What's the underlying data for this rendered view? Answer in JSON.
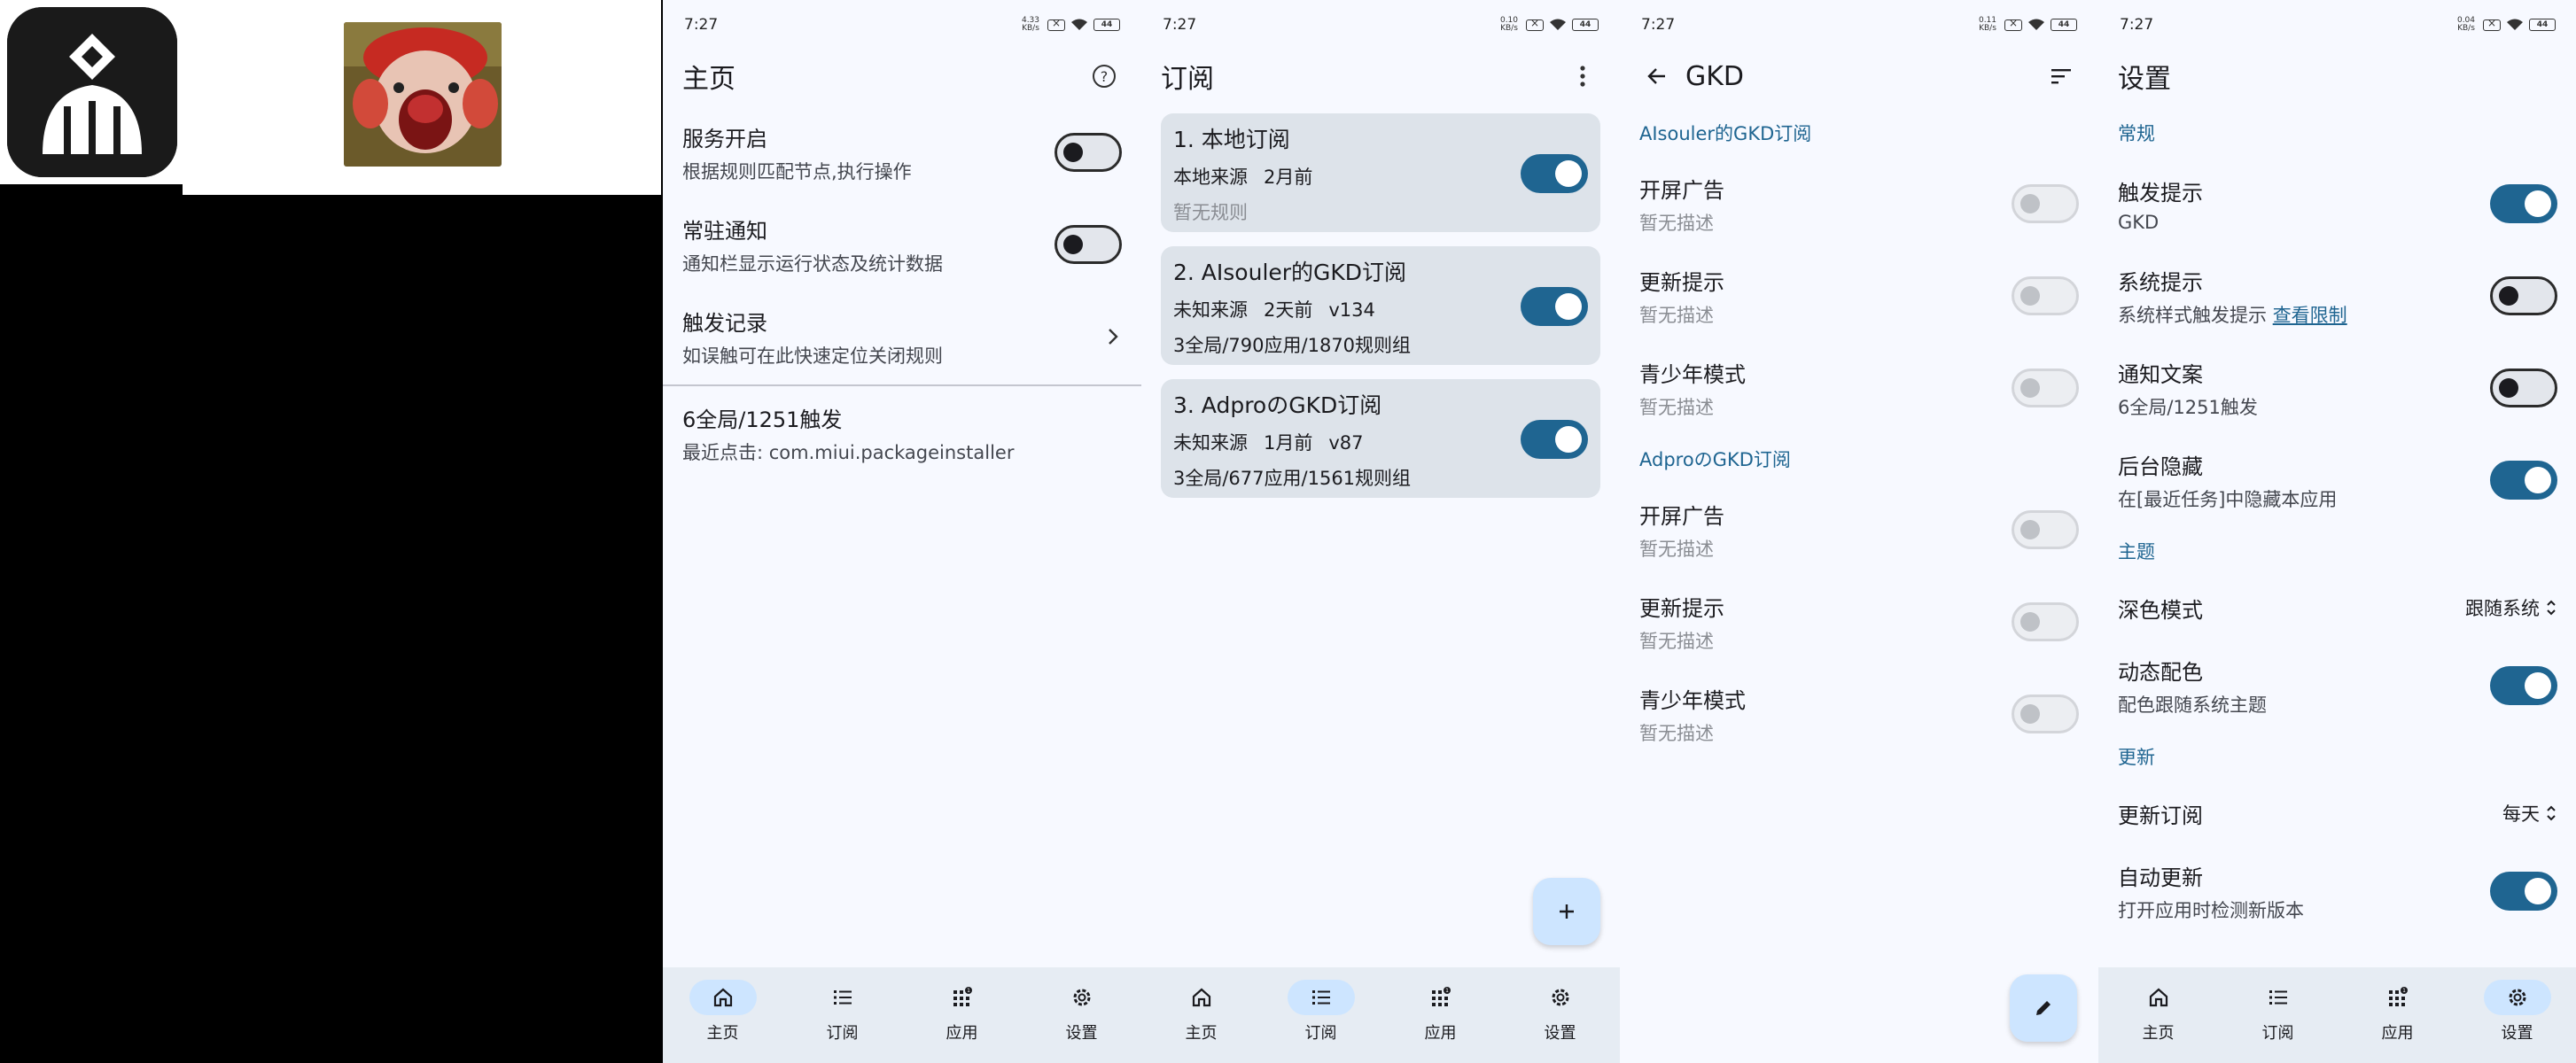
{
  "status": {
    "time": "7:27",
    "battery": "44",
    "net_speed": [
      "4.33 KB/s",
      "0.10 KB/s",
      "0.11 KB/s",
      "0.04 KB/s"
    ]
  },
  "nav": {
    "home": "主页",
    "subs": "订阅",
    "apps": "应用",
    "settings": "设置"
  },
  "home": {
    "title": "主页",
    "service": {
      "title": "服务开启",
      "sub": "根据规则匹配节点,执行操作",
      "on": false
    },
    "notify": {
      "title": "常驻通知",
      "sub": "通知栏显示运行状态及统计数据",
      "on": false
    },
    "records": {
      "title": "触发记录",
      "sub": "如误触可在此快速定位关闭规则"
    },
    "stats": {
      "title": "6全局/1251触发",
      "sub": "最近点击: com.miui.packageinstaller"
    }
  },
  "subs": {
    "title": "订阅",
    "cards": [
      {
        "title": "1. 本地订阅",
        "meta": [
          "本地来源",
          "2月前"
        ],
        "stat": "暂无规则",
        "muted": true,
        "on": true
      },
      {
        "title": "2. AIsouler的GKD订阅",
        "meta": [
          "未知来源",
          "2天前",
          "v134"
        ],
        "stat": "3全局/790应用/1870规则组",
        "muted": false,
        "on": true
      },
      {
        "title": "3. AdproのGKD订阅",
        "meta": [
          "未知来源",
          "1月前",
          "v87"
        ],
        "stat": "3全局/677应用/1561规则组",
        "muted": false,
        "on": true
      }
    ]
  },
  "gkd": {
    "title": "GKD",
    "groups": [
      {
        "header": "AIsouler的GKD订阅",
        "items": [
          {
            "title": "开屏广告",
            "sub": "暂无描述"
          },
          {
            "title": "更新提示",
            "sub": "暂无描述"
          },
          {
            "title": "青少年模式",
            "sub": "暂无描述"
          }
        ]
      },
      {
        "header": "AdproのGKD订阅",
        "items": [
          {
            "title": "开屏广告",
            "sub": "暂无描述"
          },
          {
            "title": "更新提示",
            "sub": "暂无描述"
          },
          {
            "title": "青少年模式",
            "sub": "暂无描述"
          }
        ]
      }
    ]
  },
  "settings": {
    "title": "设置",
    "general_header": "常规",
    "trigger_tip": {
      "title": "触发提示",
      "sub": "GKD",
      "on": true
    },
    "system_tip": {
      "title": "系统提示",
      "sub": "系统样式触发提示 ",
      "link": "查看限制",
      "on": false
    },
    "notify_text": {
      "title": "通知文案",
      "sub": "6全局/1251触发",
      "on": false
    },
    "bg_hide": {
      "title": "后台隐藏",
      "sub": "在[最近任务]中隐藏本应用",
      "on": true
    },
    "theme_header": "主题",
    "dark_mode": {
      "title": "深色模式",
      "value": "跟随系统"
    },
    "dynamic_color": {
      "title": "动态配色",
      "sub": "配色跟随系统主题",
      "on": true
    },
    "update_header": "更新",
    "update_subs": {
      "title": "更新订阅",
      "value": "每天"
    },
    "auto_update": {
      "title": "自动更新",
      "sub": "打开应用时检测新版本",
      "on": true
    }
  },
  "colors": {
    "accent": "#1f6591",
    "background": "#f7f9ff",
    "card": "#dde3ea",
    "nav_bg": "#e6ecf3",
    "active_pill": "#cde5ff"
  }
}
